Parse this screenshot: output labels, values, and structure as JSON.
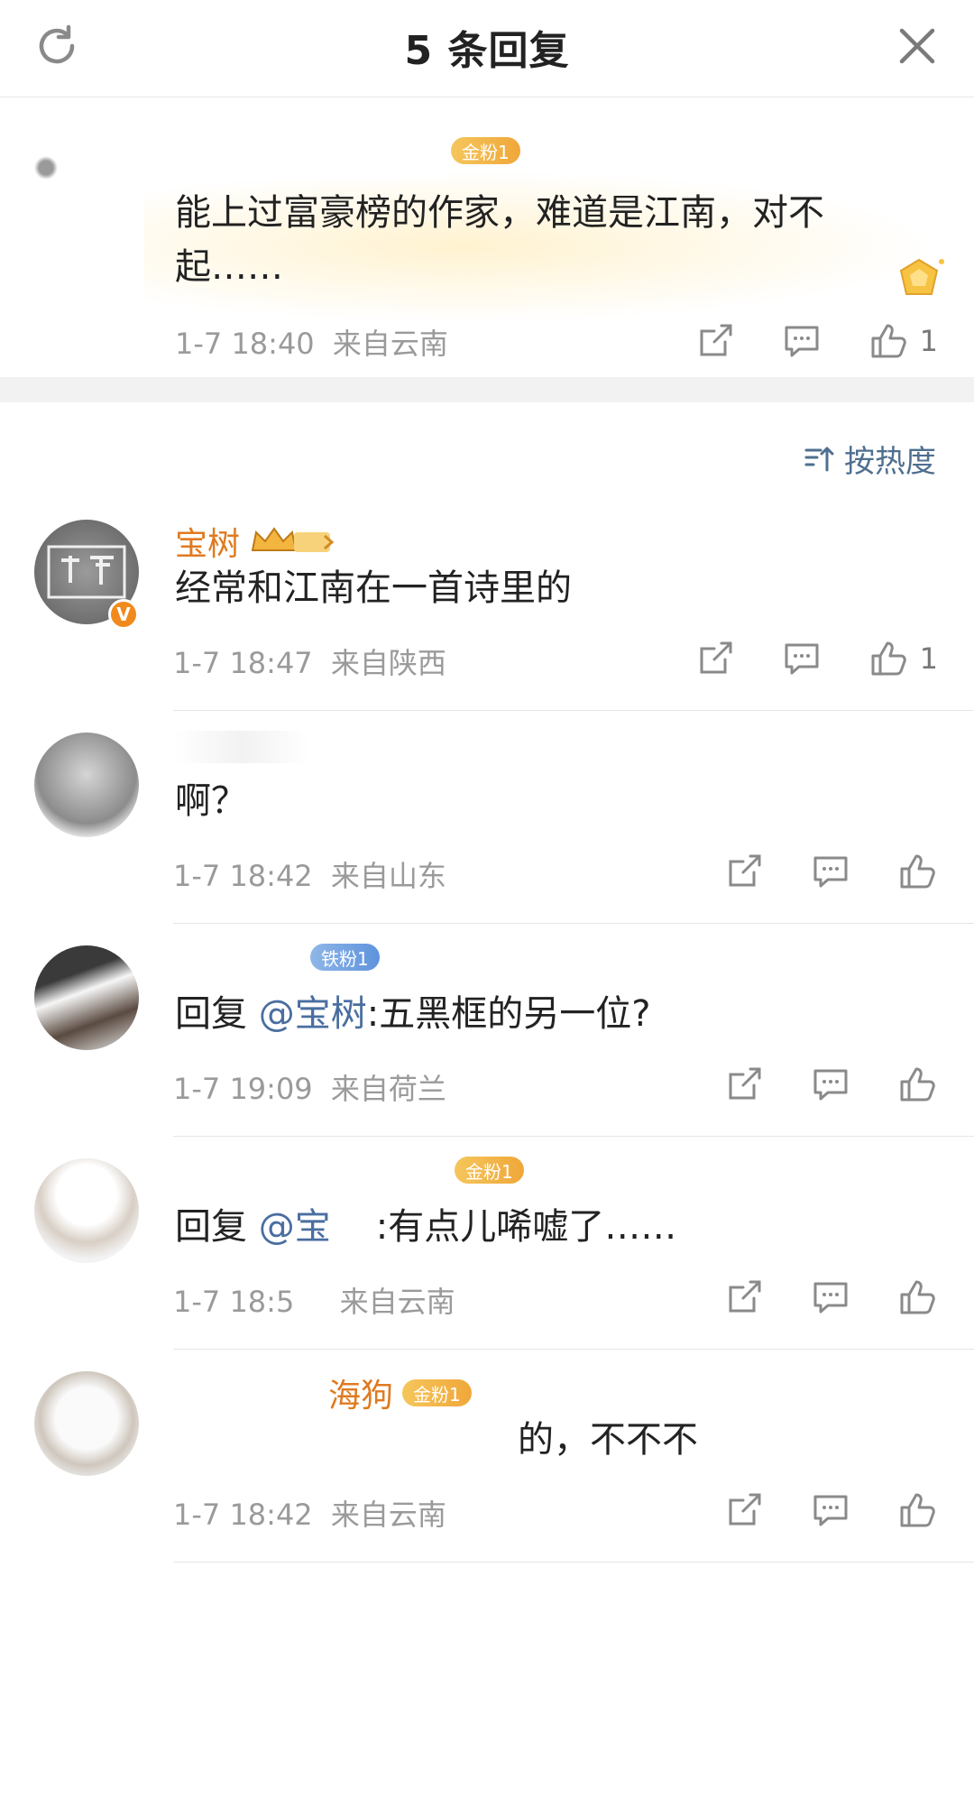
{
  "header": {
    "title": "5 条回复"
  },
  "origin": {
    "text": "能上过富豪榜的作家，难道是江南，对不起……",
    "fan_badge": "金粉1",
    "time": "1-7 18:40",
    "location": "来自云南",
    "likes": "1"
  },
  "sort": {
    "label": "按热度"
  },
  "comments": [
    {
      "name": "宝树",
      "body": "经常和江南在一首诗里的",
      "time": "1-7 18:47",
      "location": "来自陕西",
      "likes": "1"
    },
    {
      "name": "",
      "body": "啊？",
      "time": "1-7 18:42",
      "location": "来自山东",
      "likes": ""
    },
    {
      "name": "",
      "badge": "铁粉1",
      "reply_prefix": "回复 ",
      "reply_to": "@宝树",
      "body": ":五黑框的另一位?",
      "time": "1-7 19:09",
      "location": "来自荷兰",
      "likes": ""
    },
    {
      "name": "",
      "badge": "金粉1",
      "reply_prefix": "回复 ",
      "reply_to": "@宝",
      "body": ":有点儿唏嘘了……",
      "time": "1-7 18:5",
      "location": "来自云南",
      "likes": ""
    },
    {
      "name": "海狗",
      "badge": "金粉1",
      "body": "的，不不不",
      "time": "1-7 18:42",
      "location": "来自云南",
      "likes": ""
    }
  ]
}
